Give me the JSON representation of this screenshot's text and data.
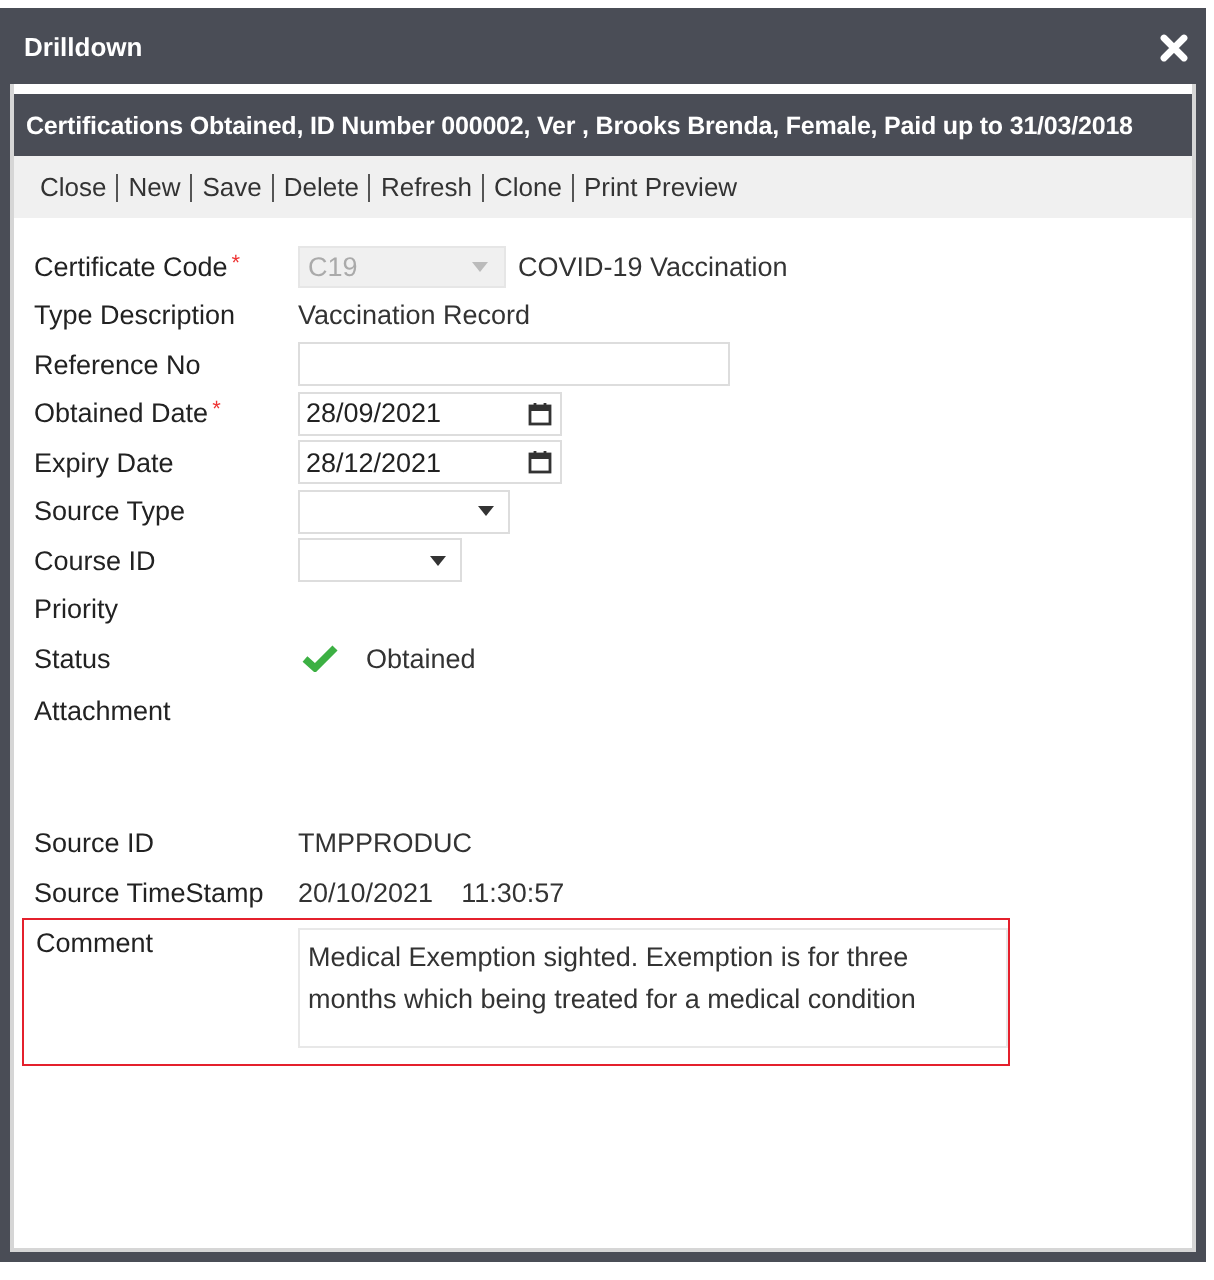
{
  "window": {
    "title": "Drilldown"
  },
  "header": "Certifications Obtained, ID Number 000002, Ver , Brooks Brenda, Female, Paid up to 31/03/2018",
  "toolbar": [
    "Close",
    "New",
    "Save",
    "Delete",
    "Refresh",
    "Clone",
    "Print Preview"
  ],
  "fields": [
    {
      "kind": "combo",
      "label": "Certificate Code",
      "required_mark": "*",
      "value": "C19",
      "disabled": true,
      "description": "COVID-19 Vaccination"
    },
    {
      "kind": "text",
      "label": "Type Description",
      "value": "Vaccination Record"
    },
    {
      "kind": "input",
      "label": "Reference No"
    },
    {
      "kind": "date",
      "label": "Obtained Date",
      "required_mark": "*",
      "value": "28/09/2021"
    },
    {
      "kind": "date",
      "label": "Expiry Date",
      "value": "28/12/2021"
    },
    {
      "kind": "select",
      "label": "Source Type"
    },
    {
      "kind": "select",
      "label": "Course ID"
    },
    {
      "kind": "text",
      "label": "Priority"
    },
    {
      "kind": "status",
      "label": "Status",
      "value": "Obtained"
    },
    {
      "kind": "attachment",
      "label": "Attachment"
    },
    {
      "kind": "text",
      "label": "Source ID",
      "value": "TMPPRODUC"
    },
    {
      "kind": "timestamp",
      "label": "Source TimeStamp",
      "value": "20/10/2021",
      "time": "11:30:57"
    },
    {
      "kind": "textarea",
      "label": "Comment",
      "value": "Medical Exemption sighted. Exemption is for three months which being treated for a medical condition",
      "highlighted": true
    }
  ]
}
